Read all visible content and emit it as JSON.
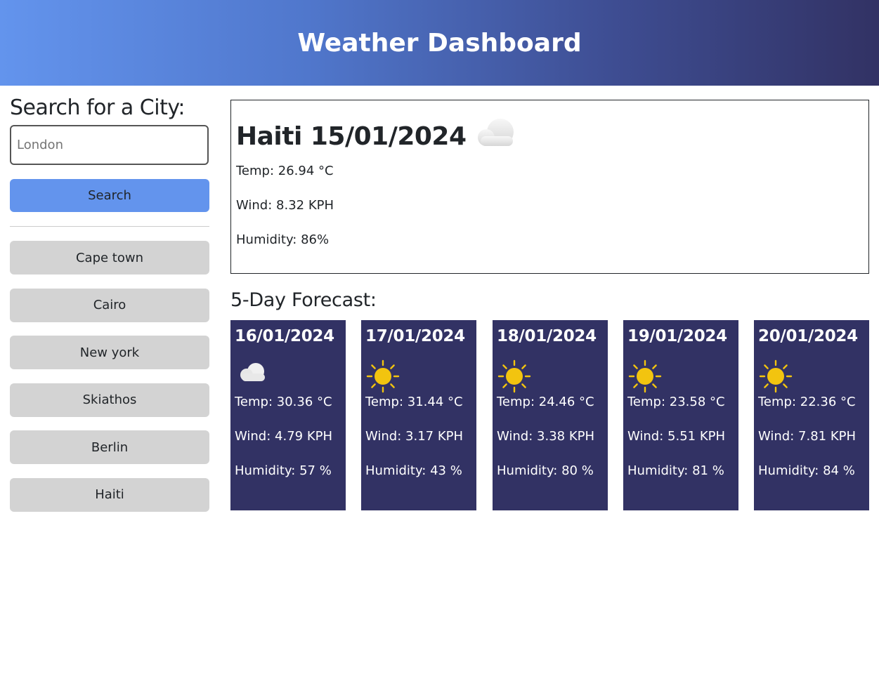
{
  "header": {
    "title": "Weather Dashboard"
  },
  "sidebar": {
    "heading": "Search for a City:",
    "search_placeholder": "London",
    "search_button": "Search",
    "history": [
      "Cape town",
      "Cairo",
      "New york",
      "Skiathos",
      "Berlin",
      "Haiti"
    ]
  },
  "current": {
    "title": "Haiti 15/01/2024",
    "icon": "cloud-icon",
    "temp": "Temp: 26.94 °C",
    "wind": "Wind: 8.32 KPH",
    "humidity": "Humidity: 86%"
  },
  "forecast": {
    "heading": "5-Day Forecast:",
    "days": [
      {
        "date": "16/01/2024",
        "icon": "cloud-icon",
        "temp": "Temp: 30.36 °C",
        "wind": "Wind: 4.79 KPH",
        "humidity": "Humidity: 57 %"
      },
      {
        "date": "17/01/2024",
        "icon": "sun-icon",
        "temp": "Temp: 31.44 °C",
        "wind": "Wind: 3.17 KPH",
        "humidity": "Humidity: 43 %"
      },
      {
        "date": "18/01/2024",
        "icon": "sun-icon",
        "temp": "Temp: 24.46 °C",
        "wind": "Wind: 3.38 KPH",
        "humidity": "Humidity: 80 %"
      },
      {
        "date": "19/01/2024",
        "icon": "sun-icon",
        "temp": "Temp: 23.58 °C",
        "wind": "Wind: 5.51 KPH",
        "humidity": "Humidity: 81 %"
      },
      {
        "date": "20/01/2024",
        "icon": "sun-icon",
        "temp": "Temp: 22.36 °C",
        "wind": "Wind: 7.81 KPH",
        "humidity": "Humidity: 84 %"
      }
    ]
  },
  "colors": {
    "header_start": "#6394ed",
    "header_end": "#323264",
    "search_button": "#6394ed",
    "history_button": "#d3d3d3",
    "forecast_card": "#323264",
    "sun": "#f2c40f"
  }
}
